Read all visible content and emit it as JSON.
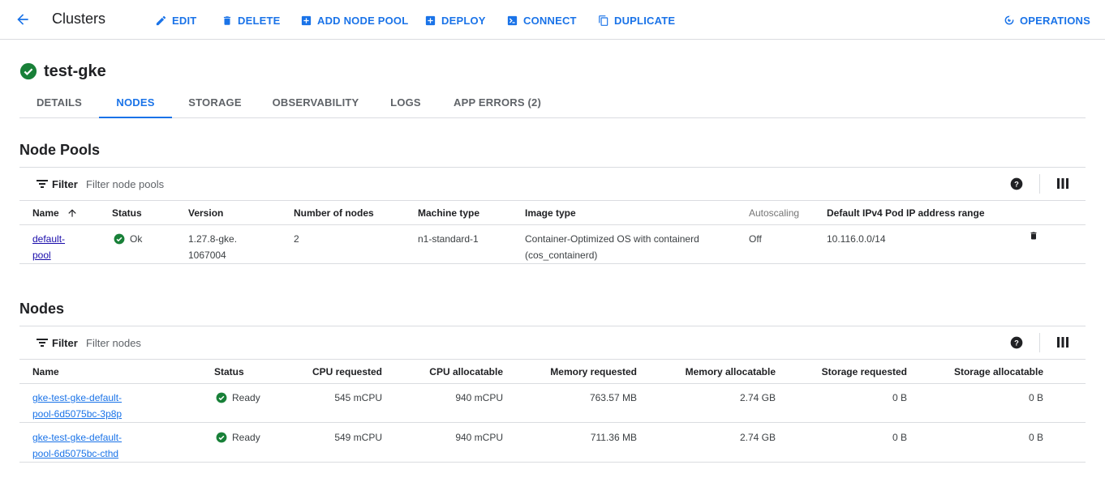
{
  "header": {
    "title": "Clusters",
    "actions": [
      {
        "label": "EDIT",
        "icon": "pencil-icon"
      },
      {
        "label": "DELETE",
        "icon": "trash-icon"
      },
      {
        "label": "ADD NODE POOL",
        "icon": "plus-box-icon"
      },
      {
        "label": "DEPLOY",
        "icon": "plus-box-icon"
      },
      {
        "label": "CONNECT",
        "icon": "terminal-icon"
      },
      {
        "label": "DUPLICATE",
        "icon": "copy-icon"
      }
    ],
    "operations_label": "OPERATIONS"
  },
  "cluster": {
    "name": "test-gke",
    "status_color": "#188038"
  },
  "tabs": [
    "DETAILS",
    "NODES",
    "STORAGE",
    "OBSERVABILITY",
    "LOGS",
    "APP ERRORS (2)"
  ],
  "active_tab": "NODES",
  "node_pools": {
    "title": "Node Pools",
    "filter_label": "Filter",
    "filter_placeholder": "Filter node pools",
    "columns": [
      "Name",
      "Status",
      "Version",
      "Number of nodes",
      "Machine type",
      "Image type",
      "Autoscaling",
      "Default IPv4 Pod IP address range"
    ],
    "sort_column": "Name",
    "rows": [
      {
        "name_line1": "default-",
        "name_line2": "pool",
        "status": "Ok",
        "version_line1": "1.27.8-gke.",
        "version_line2": "1067004",
        "nodes": "2",
        "machine_type": "n1-standard-1",
        "image_line1": "Container-Optimized OS with containerd",
        "image_line2": "(cos_containerd)",
        "autoscaling": "Off",
        "ip_range": "10.116.0.0/14"
      }
    ]
  },
  "nodes": {
    "title": "Nodes",
    "filter_label": "Filter",
    "filter_placeholder": "Filter nodes",
    "columns": [
      "Name",
      "Status",
      "CPU requested",
      "CPU allocatable",
      "Memory requested",
      "Memory allocatable",
      "Storage requested",
      "Storage allocatable"
    ],
    "rows": [
      {
        "name_line1": "gke-test-gke-default-",
        "name_line2": "pool-6d5075bc-3p8p",
        "status": "Ready",
        "cpu_requested": "545 mCPU",
        "cpu_allocatable": "940 mCPU",
        "mem_requested": "763.57 MB",
        "mem_allocatable": "2.74 GB",
        "storage_requested": "0 B",
        "storage_allocatable": "0 B"
      },
      {
        "name_line1": "gke-test-gke-default-",
        "name_line2": "pool-6d5075bc-cthd",
        "status": "Ready",
        "cpu_requested": "549 mCPU",
        "cpu_allocatable": "940 mCPU",
        "mem_requested": "711.36 MB",
        "mem_allocatable": "2.74 GB",
        "storage_requested": "0 B",
        "storage_allocatable": "0 B"
      }
    ]
  },
  "colors": {
    "accent": "#1a73e8",
    "success": "#188038",
    "link_visited": "#1a0dab"
  }
}
